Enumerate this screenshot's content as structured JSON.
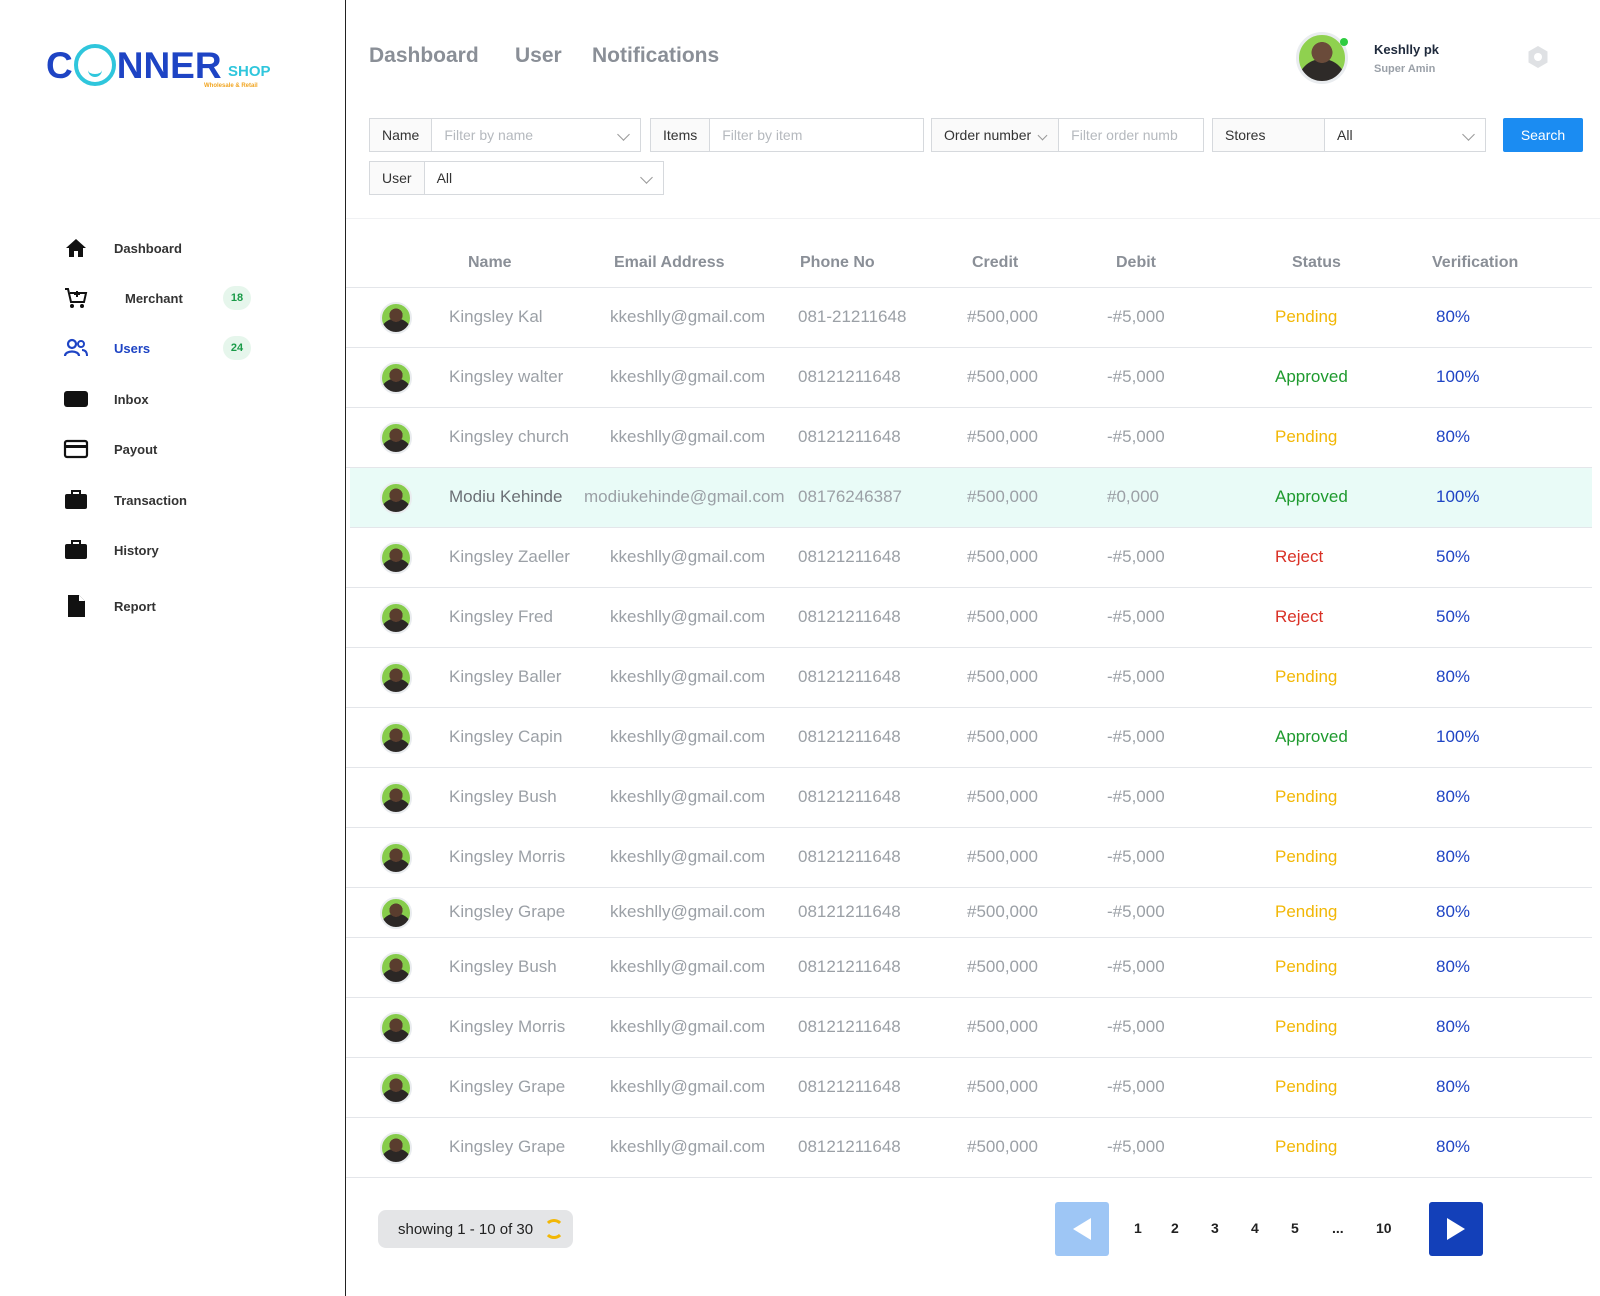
{
  "brand": {
    "logo_part1": "C",
    "logo_part2": "NNER",
    "logo_shop": "SHOP",
    "logo_tagline": "Wholesale & Retail"
  },
  "sidebar": {
    "items": [
      {
        "label": "Dashboard",
        "icon": "home-icon"
      },
      {
        "label": "Merchant",
        "icon": "cart-icon",
        "badge": "18"
      },
      {
        "label": "Users",
        "icon": "users-icon",
        "badge": "24",
        "active": true
      },
      {
        "label": "Inbox",
        "icon": "inbox-icon"
      },
      {
        "label": "Payout",
        "icon": "card-icon"
      },
      {
        "label": "Transaction",
        "icon": "briefcase-icon"
      },
      {
        "label": "History",
        "icon": "briefcase-icon"
      },
      {
        "label": "Report",
        "icon": "document-icon"
      }
    ]
  },
  "header": {
    "tabs": [
      "Dashboard",
      "User",
      "Notifications"
    ],
    "user_name": "Keshlly pk",
    "user_role": "Super Amin"
  },
  "filters": {
    "name_label": "Name",
    "name_placeholder": "Filter by name",
    "items_label": "Items",
    "items_placeholder": "Filter by item",
    "order_label": "Order number",
    "order_placeholder": "Filter order numb",
    "stores_label": "Stores",
    "stores_value": "All",
    "user_label": "User",
    "user_value": "All",
    "search_label": "Search"
  },
  "table": {
    "headers": [
      "Name",
      "Email Address",
      "Phone No",
      "Credit",
      "Debit",
      "Status",
      "Verification"
    ],
    "rows": [
      {
        "name": "Kingsley  Kal",
        "email": "kkeshlly@gmail.com",
        "phone": "081-21211648",
        "credit": "#500,000",
        "debit": "-#5,000",
        "status": "Pending",
        "verification": "80%"
      },
      {
        "name": "Kingsley walter",
        "email": "kkeshlly@gmail.com",
        "phone": "08121211648",
        "credit": "#500,000",
        "debit": "-#5,000",
        "status": "Approved",
        "verification": "100%"
      },
      {
        "name": "Kingsley church",
        "email": "kkeshlly@gmail.com",
        "phone": "08121211648",
        "credit": "#500,000",
        "debit": "-#5,000",
        "status": "Pending",
        "verification": "80%"
      },
      {
        "name": "Modiu Kehinde",
        "email": "modiukehinde@gmail.com",
        "phone": "08176246387",
        "credit": "#500,000",
        "debit": "#0,000",
        "status": "Approved",
        "verification": "100%",
        "highlighted": true
      },
      {
        "name": "Kingsley Zaeller",
        "email": "kkeshlly@gmail.com",
        "phone": "08121211648",
        "credit": "#500,000",
        "debit": "-#5,000",
        "status": "Reject",
        "verification": "50%"
      },
      {
        "name": "Kingsley Fred",
        "email": "kkeshlly@gmail.com",
        "phone": "08121211648",
        "credit": "#500,000",
        "debit": "-#5,000",
        "status": "Reject",
        "verification": "50%"
      },
      {
        "name": "Kingsley Baller",
        "email": "kkeshlly@gmail.com",
        "phone": "08121211648",
        "credit": "#500,000",
        "debit": "-#5,000",
        "status": "Pending",
        "verification": "80%"
      },
      {
        "name": "Kingsley Capin",
        "email": "kkeshlly@gmail.com",
        "phone": "08121211648",
        "credit": "#500,000",
        "debit": "-#5,000",
        "status": "Approved",
        "verification": "100%"
      },
      {
        "name": "Kingsley Bush",
        "email": "kkeshlly@gmail.com",
        "phone": "08121211648",
        "credit": "#500,000",
        "debit": "-#5,000",
        "status": "Pending",
        "verification": "80%"
      },
      {
        "name": "Kingsley Morris",
        "email": "kkeshlly@gmail.com",
        "phone": "08121211648",
        "credit": "#500,000",
        "debit": "-#5,000",
        "status": "Pending",
        "verification": "80%"
      },
      {
        "name": "Kingsley Grape",
        "email": "kkeshlly@gmail.com",
        "phone": "08121211648",
        "credit": "#500,000",
        "debit": "-#5,000",
        "status": "Pending",
        "verification": "80%"
      },
      {
        "name": "Kingsley Bush",
        "email": "kkeshlly@gmail.com",
        "phone": "08121211648",
        "credit": "#500,000",
        "debit": "-#5,000",
        "status": "Pending",
        "verification": "80%"
      },
      {
        "name": "Kingsley Morris",
        "email": "kkeshlly@gmail.com",
        "phone": "08121211648",
        "credit": "#500,000",
        "debit": "-#5,000",
        "status": "Pending",
        "verification": "80%"
      },
      {
        "name": "Kingsley Grape",
        "email": "kkeshlly@gmail.com",
        "phone": "08121211648",
        "credit": "#500,000",
        "debit": "-#5,000",
        "status": "Pending",
        "verification": "80%"
      },
      {
        "name": "Kingsley Grape",
        "email": "kkeshlly@gmail.com",
        "phone": "08121211648",
        "credit": "#500,000",
        "debit": "-#5,000",
        "status": "Pending",
        "verification": "80%"
      }
    ]
  },
  "pagination": {
    "showing": "showing 1 - 10 of 30",
    "pages": [
      "1",
      "2",
      "3",
      "4",
      "5",
      "...",
      "10"
    ]
  },
  "colors": {
    "brand_blue": "#1e44c4",
    "accent_cyan": "#2fc6dc",
    "pending": "#f2b705",
    "approved": "#1e9a2e",
    "reject": "#d93025",
    "search_button": "#1b8cf2"
  }
}
